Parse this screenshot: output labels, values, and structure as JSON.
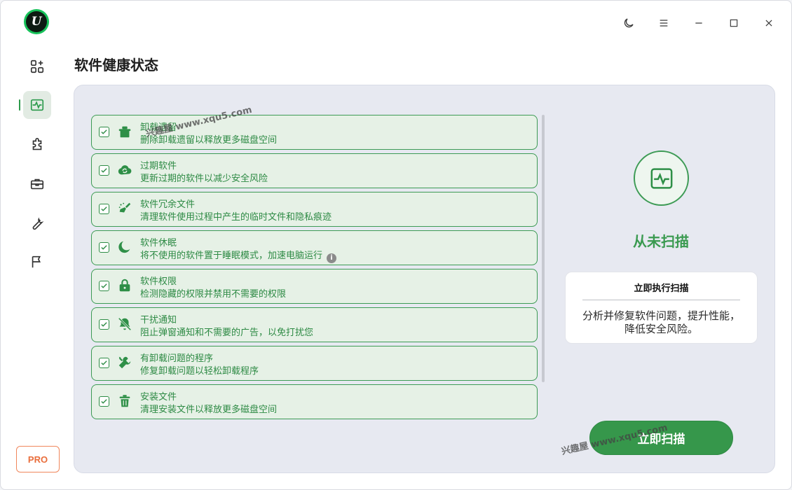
{
  "app": {
    "logo_letter": "U"
  },
  "window_controls": [
    "moon-icon",
    "menu-icon",
    "minimize-icon",
    "maximize-icon",
    "close-icon"
  ],
  "sidebar": {
    "items": [
      {
        "name": "apps",
        "icon": "apps-grid-icon"
      },
      {
        "name": "health",
        "icon": "pulse-icon",
        "active": true
      },
      {
        "name": "plugins",
        "icon": "puzzle-icon"
      },
      {
        "name": "toolbox",
        "icon": "toolbox-icon"
      },
      {
        "name": "tools",
        "icon": "wrench-icon"
      },
      {
        "name": "action-center",
        "icon": "flag-icon"
      }
    ],
    "pro_label": "PRO"
  },
  "page": {
    "title": "软件健康状态"
  },
  "items": [
    {
      "title": "卸载遗留",
      "desc": "删除卸载遗留以释放更多磁盘空间",
      "icon": "leftover-icon",
      "checked": true
    },
    {
      "title": "过期软件",
      "desc": "更新过期的软件以减少安全风险",
      "icon": "update-cloud-icon",
      "checked": true
    },
    {
      "title": "软件冗余文件",
      "desc": "清理软件使用过程中产生的临时文件和隐私痕迹",
      "icon": "broom-icon",
      "checked": true
    },
    {
      "title": "软件休眠",
      "desc": "将不使用的软件置于睡眠模式，加速电脑运行",
      "icon": "sleep-moon-icon",
      "checked": true,
      "info": true
    },
    {
      "title": "软件权限",
      "desc": "检测隐藏的权限并禁用不需要的权限",
      "icon": "lock-icon",
      "checked": true
    },
    {
      "title": "干扰通知",
      "desc": "阻止弹窗通知和不需要的广告，以免打扰您",
      "icon": "bell-off-icon",
      "checked": true
    },
    {
      "title": "有卸载问题的程序",
      "desc": "修复卸载问题以轻松卸载程序",
      "icon": "tools-icon",
      "checked": true
    },
    {
      "title": "安装文件",
      "desc": "清理安装文件以释放更多磁盘空间",
      "icon": "trash-icon",
      "checked": true
    }
  ],
  "status": {
    "icon": "pulse-icon",
    "text": "从未扫描"
  },
  "card": {
    "title": "立即执行扫描",
    "body": "分析并修复软件问题，提升性能，降低安全风险。"
  },
  "scan_button": {
    "label": "立即扫描"
  },
  "watermarks": [
    "兴趣屋 www.xqu5.com",
    "兴趣屋 www.xqu5.com"
  ],
  "colors": {
    "accent": "#36974b",
    "item_bg": "#e6f1e6",
    "panel_bg": "#e7e9f1",
    "pro": "#e96d3b"
  }
}
